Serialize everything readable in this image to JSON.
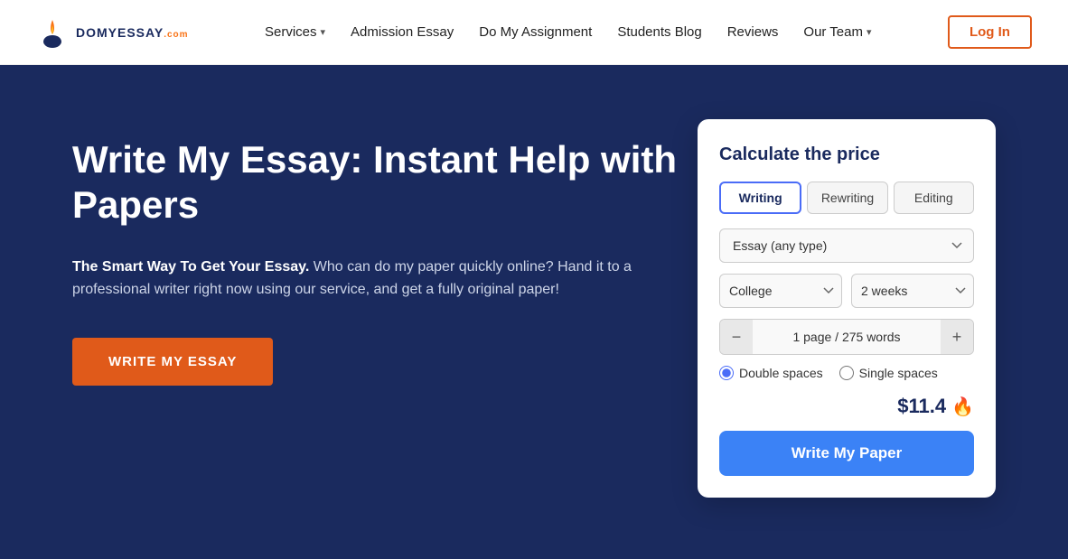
{
  "nav": {
    "logo_text_line1": "DOMYESSAY",
    "logo_text_line2": ".com",
    "links": [
      {
        "label": "Services",
        "has_dropdown": true
      },
      {
        "label": "Admission Essay",
        "has_dropdown": false
      },
      {
        "label": "Do My Assignment",
        "has_dropdown": false
      },
      {
        "label": "Students Blog",
        "has_dropdown": false
      },
      {
        "label": "Reviews",
        "has_dropdown": false
      },
      {
        "label": "Our Team",
        "has_dropdown": true
      }
    ],
    "login_label": "Log In"
  },
  "hero": {
    "title": "Write My Essay: Instant Help with Papers",
    "desc_bold": "The Smart Way To Get Your Essay.",
    "desc_rest": " Who can do my paper quickly online? Hand it to a professional writer right now using our service, and get a fully original paper!",
    "cta_label": "WRITE MY ESSAY"
  },
  "calculator": {
    "title": "Calculate the price",
    "tabs": [
      {
        "label": "Writing",
        "active": true
      },
      {
        "label": "Rewriting",
        "active": false
      },
      {
        "label": "Editing",
        "active": false
      }
    ],
    "type_placeholder": "Essay (any type)",
    "level_options": [
      "College"
    ],
    "deadline_options": [
      "2 weeks"
    ],
    "pages_label": "1 page / 275 words",
    "spacing_options": [
      {
        "label": "Double spaces",
        "checked": true
      },
      {
        "label": "Single spaces",
        "checked": false
      }
    ],
    "price": "$11.4",
    "submit_label": "Write My Paper"
  }
}
